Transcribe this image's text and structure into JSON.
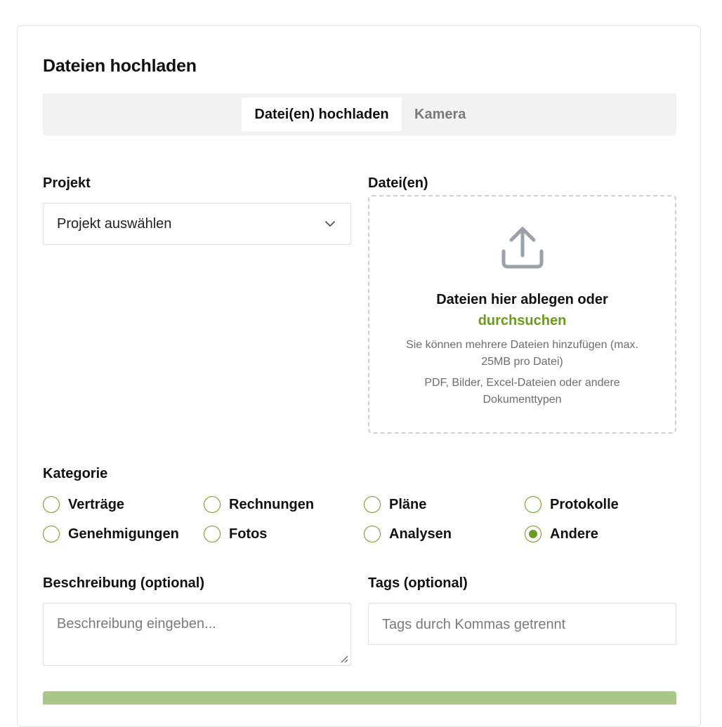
{
  "dialog": {
    "title": "Dateien hochladen"
  },
  "tabs": [
    {
      "label": "Datei(en) hochladen",
      "active": true
    },
    {
      "label": "Kamera",
      "active": false
    }
  ],
  "project": {
    "label": "Projekt",
    "selected": "Projekt auswählen"
  },
  "files": {
    "label": "Datei(en)",
    "drop_text": "Dateien hier ablegen oder",
    "browse_link": "durchsuchen",
    "hint_multiple": "Sie können mehrere Dateien hinzufügen (max. 25MB pro Datei)",
    "hint_types": "PDF, Bilder, Excel-Dateien oder andere Dokumenttypen",
    "icon": "upload-icon"
  },
  "category": {
    "label": "Kategorie",
    "options": [
      {
        "label": "Verträge",
        "checked": false
      },
      {
        "label": "Rechnungen",
        "checked": false
      },
      {
        "label": "Pläne",
        "checked": false
      },
      {
        "label": "Protokolle",
        "checked": false
      },
      {
        "label": "Genehmigungen",
        "checked": false
      },
      {
        "label": "Fotos",
        "checked": false
      },
      {
        "label": "Analysen",
        "checked": false
      },
      {
        "label": "Andere",
        "checked": true
      }
    ]
  },
  "description": {
    "label": "Beschreibung (optional)",
    "placeholder": "Beschreibung eingeben...",
    "value": ""
  },
  "tags": {
    "label": "Tags (optional)",
    "placeholder": "Tags durch Kommas getrennt",
    "value": ""
  },
  "colors": {
    "accent": "#6b9a1f",
    "submit_bg": "#aac789",
    "tab_bar_bg": "#f2f2f2"
  }
}
